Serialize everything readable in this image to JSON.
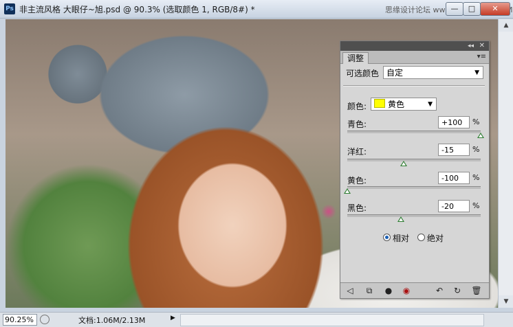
{
  "window": {
    "title": "非主流风格 大眼仔~旭.psd @ 90.3% (选取颜色 1, RGB/8#) *",
    "watermark": "思缘设计论坛 www.MISSYUAN.COM",
    "buttons": {
      "minimize": "—",
      "maximize": "□",
      "close": "✕"
    }
  },
  "panel": {
    "tab": "调整",
    "preset_label": "可选颜色",
    "preset_value": "自定",
    "colors_label": "颜色:",
    "colors_value": "黄色",
    "swatch_color": "#ffff00",
    "sliders": [
      {
        "label": "青色:",
        "value": "+100",
        "percent": "%",
        "level": 100
      },
      {
        "label": "洋红:",
        "value": "-15",
        "percent": "%",
        "level": -15
      },
      {
        "label": "黄色:",
        "value": "-100",
        "percent": "%",
        "level": -100
      },
      {
        "label": "黑色:",
        "value": "-20",
        "percent": "%",
        "level": -20
      }
    ],
    "method": {
      "relative": "相对",
      "absolute": "绝对",
      "selected": "relative"
    }
  },
  "status": {
    "zoom": "90.25%",
    "doc_info": "文档:1.06M/2.13M"
  },
  "icons": {
    "panel_menu": "panel-menu-icon",
    "toolbar": [
      "back-arrow-icon",
      "clip-layer-icon",
      "visibility-icon",
      "view-previous-icon",
      "reset-icon",
      "delete-icon"
    ]
  }
}
